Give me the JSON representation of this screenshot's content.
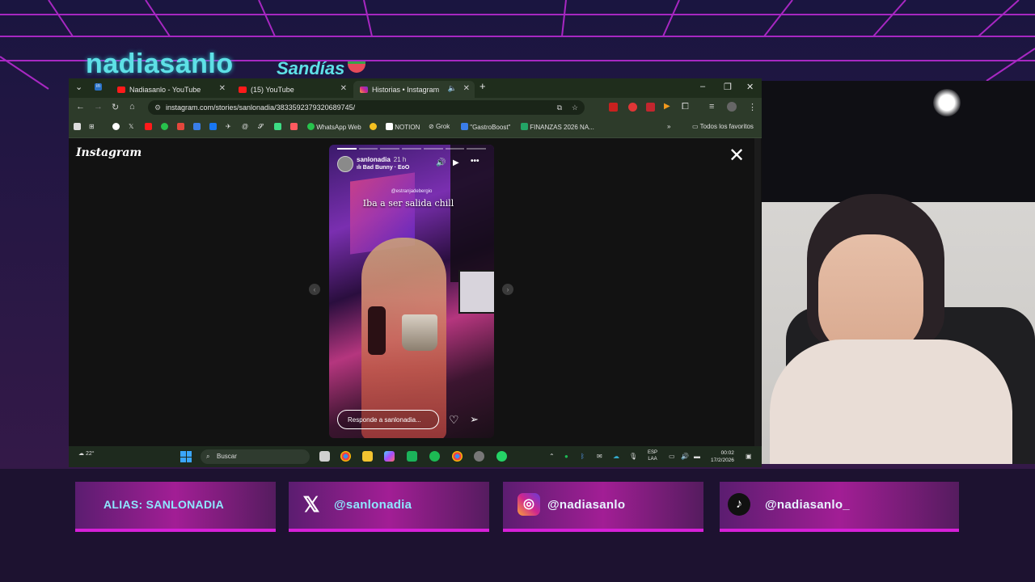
{
  "overlay": {
    "title": "nadiasanlo",
    "subtitle": "Sandías",
    "colors": {
      "accent": "#5ee0e6",
      "card": "#a21e95",
      "card_border": "#d620d8"
    }
  },
  "browser": {
    "tabs": [
      {
        "label": "Nadiasanlo - YouTube",
        "icon": "youtube-icon"
      },
      {
        "label": "(15) YouTube",
        "icon": "youtube-icon"
      },
      {
        "label": "Historias • Instagram",
        "icon": "instagram-icon",
        "active": true
      }
    ],
    "url": "instagram.com/stories/sanlonadia/3833592379320689745/",
    "bookmarks": [
      {
        "label": "WhatsApp Web",
        "icon": "whatsapp-icon"
      },
      {
        "label": "NOTION",
        "icon": "notion-icon"
      },
      {
        "label": "Grok",
        "icon": "grok-icon"
      },
      {
        "label": "\"GastroBoost\"",
        "icon": "docs-icon"
      },
      {
        "label": "FINANZAS 2026 NA...",
        "icon": "sheets-icon"
      }
    ],
    "all_bookmarks": "Todos los favoritos"
  },
  "instagram": {
    "logo": "Instagram",
    "story": {
      "username": "sanlonadia",
      "time": "21 h",
      "music": "Bad Bunny · EoO",
      "mention": "@estranjadebergio",
      "caption": "Iba a ser salida chill",
      "reply_placeholder": "Responde a sanlonadia...",
      "progress_segments": 7,
      "progress_active": 1
    }
  },
  "taskbar": {
    "temperature": "22°",
    "search": "Buscar",
    "lang_top": "ESP",
    "lang_bottom": "LAA",
    "time": "00:02",
    "date": "17/2/2026"
  },
  "socials": [
    {
      "label": "ALIAS: SANLONADIA",
      "icon": ""
    },
    {
      "label": "@sanlonadia",
      "icon": "x-icon"
    },
    {
      "label": "@nadiasanlo",
      "icon": "instagram-icon"
    },
    {
      "label": "@nadiasanlo_",
      "icon": "tiktok-icon"
    }
  ]
}
